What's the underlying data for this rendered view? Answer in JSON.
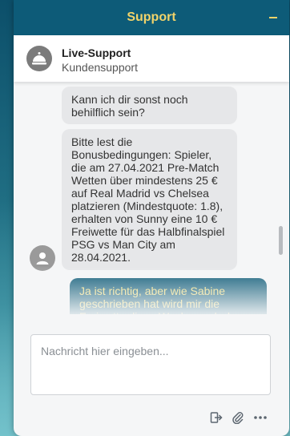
{
  "header": {
    "title": "Support"
  },
  "agent": {
    "name": "Live-Support",
    "subtitle": "Kundensupport"
  },
  "messages": [
    {
      "from": "agent",
      "text": "Kann ich dir sonst noch behilflich sein?"
    },
    {
      "from": "agent",
      "text": "Bitte lest die Bonusbedingungen: Spieler, die am 27.04.2021 Pre-Match Wetten über mindestens 25 € auf Real Madrid vs Chelsea platzieren (Mindestquote: 1.8), erhalten von Sunny eine 10 € Freiwette für das Halbfinalspiel PSG vs Man City am 28.04.2021."
    },
    {
      "from": "user",
      "text": "Ja ist richtig, aber wie Sabine geschrieben hat wird mir die Freiwette diese Woche noch der"
    }
  ],
  "composer": {
    "placeholder": "Nachricht hier eingeben..."
  },
  "icons": {
    "agent_avatar": "bell-icon",
    "user_avatar": "person-icon",
    "exit": "exit-icon",
    "attach": "paperclip-icon",
    "more": "more-icon"
  },
  "colors": {
    "header_bg": "#0d5b78",
    "header_text": "#f1d36a",
    "user_bubble": "#0b5976"
  }
}
